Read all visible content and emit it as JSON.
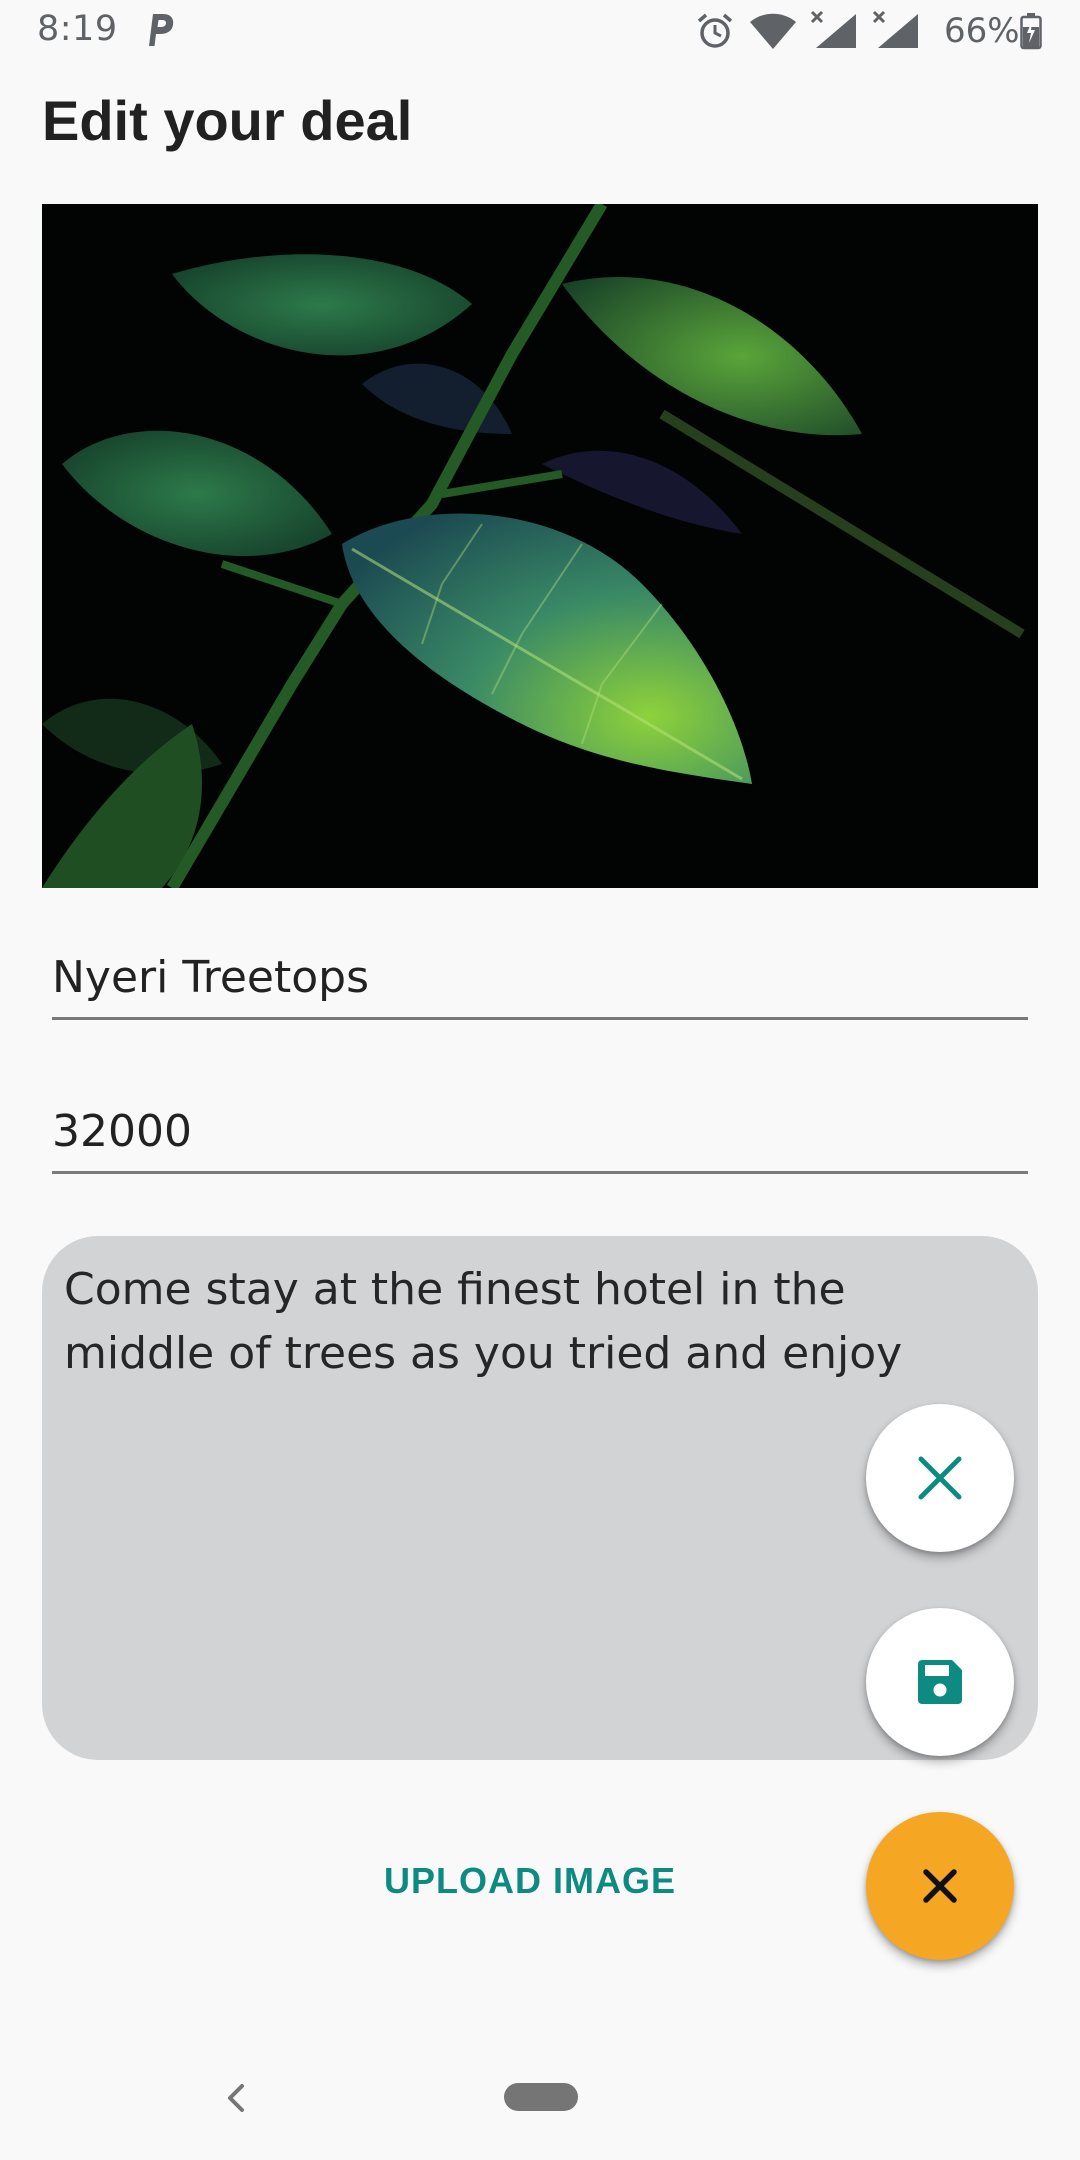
{
  "status_bar": {
    "time": "8:19",
    "battery": "66%",
    "icons": [
      "parking-icon",
      "alarm-icon",
      "wifi-icon",
      "signal-icon",
      "signal-icon",
      "battery-icon"
    ]
  },
  "title": "Edit your deal",
  "image": {
    "subject": "leaf-photo"
  },
  "form": {
    "title_value": "Nyeri Treetops",
    "price_value": "32000",
    "description_value": "Come stay at the finest hotel in the middle of trees as you tried and enjoy"
  },
  "upload_label": "UPLOAD IMAGE",
  "fabs": {
    "cancel_icon": "close-icon",
    "save_icon": "save-icon",
    "main_icon": "close-icon"
  },
  "colors": {
    "accent": "#0d8a82",
    "fab_main": "#f5a623",
    "description_bg": "#d2d3d5",
    "background": "#f9f9f9"
  },
  "nav": {
    "icons": [
      "back-icon",
      "home-pill"
    ]
  }
}
